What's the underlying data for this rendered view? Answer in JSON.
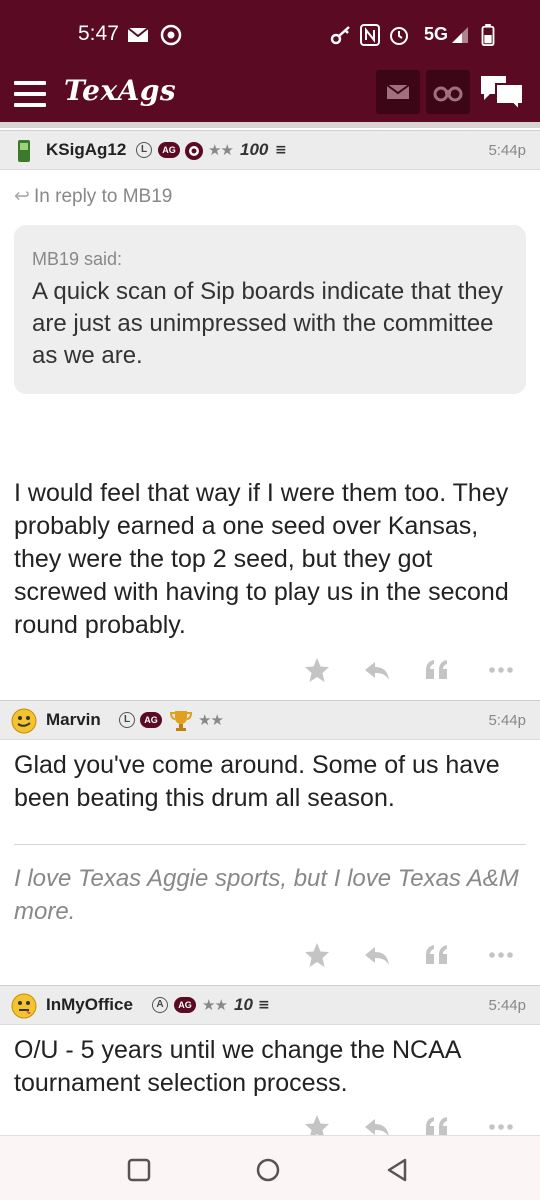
{
  "status_bar": {
    "time": "5:47",
    "network": "5G"
  },
  "header": {
    "logo": "TexAgs"
  },
  "posts": [
    {
      "username": "KSigAg12",
      "badge_l": "L",
      "badge_ag": "AG",
      "stars": "★★",
      "score": "100",
      "time": "5:44p",
      "reply_to": "In reply to MB19",
      "quote_author": "MB19 said:",
      "quote_text": "A quick scan of Sip boards indicate that they are just as unimpressed with the committee as we are.",
      "body": "I would feel that way if I were them too. They probably earned a one seed over Kansas, they were the top 2 seed, but they got screwed with having to play us in the second round probably."
    },
    {
      "username": "Marvin",
      "badge_l": "L",
      "badge_ag": "AG",
      "stars": "★★",
      "time": "5:44p",
      "body": "Glad you've come around. Some of us have been beating this drum all season.",
      "signature": "I love Texas Aggie sports, but I love Texas A&M more."
    },
    {
      "username": "InMyOffice",
      "badge_l": "A",
      "badge_ag": "AG",
      "stars": "★★",
      "score": "10",
      "time": "5:44p",
      "body": "O/U - 5 years until we change the NCAA tournament selection process."
    }
  ],
  "action_icons": [
    "star-icon",
    "reply-icon",
    "quote-icon",
    "more-icon"
  ],
  "colors": {
    "maroon": "#5a0a23",
    "maroon_dark": "#3c0616",
    "header_gray": "#ececec",
    "quote_bg": "#eeeeee"
  }
}
